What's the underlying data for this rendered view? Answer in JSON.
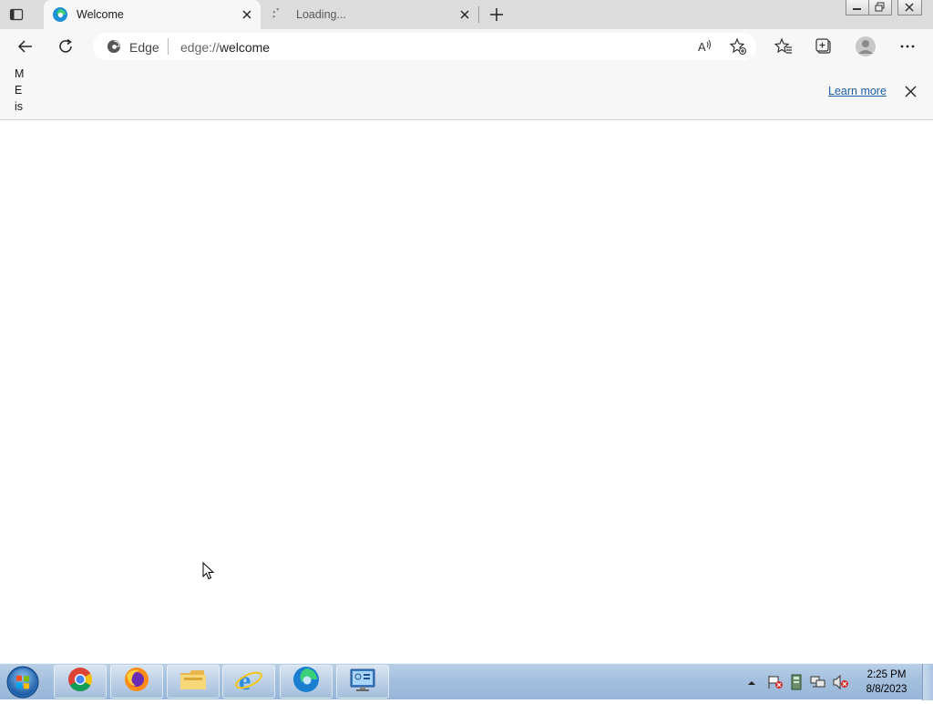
{
  "tabs": [
    {
      "title": "Welcome",
      "active": true
    },
    {
      "title": "Loading...",
      "active": false
    }
  ],
  "address_bar": {
    "identity": "Edge",
    "url_scheme": "edge://",
    "url_host": "welcome"
  },
  "infobar": {
    "text": "M E is",
    "learn_more": "Learn more"
  },
  "taskbar": {
    "time": "2:25 PM",
    "date": "8/8/2023",
    "apps": [
      "chrome-icon",
      "firefox-icon",
      "file-explorer-icon",
      "internet-explorer-icon",
      "edge-icon",
      "control-panel-icon"
    ]
  },
  "colors": {
    "tabstrip": "#dcdcdc",
    "toolbar": "#f7f7f7",
    "link": "#1f5ca8",
    "taskbar": "#a5c0de"
  }
}
